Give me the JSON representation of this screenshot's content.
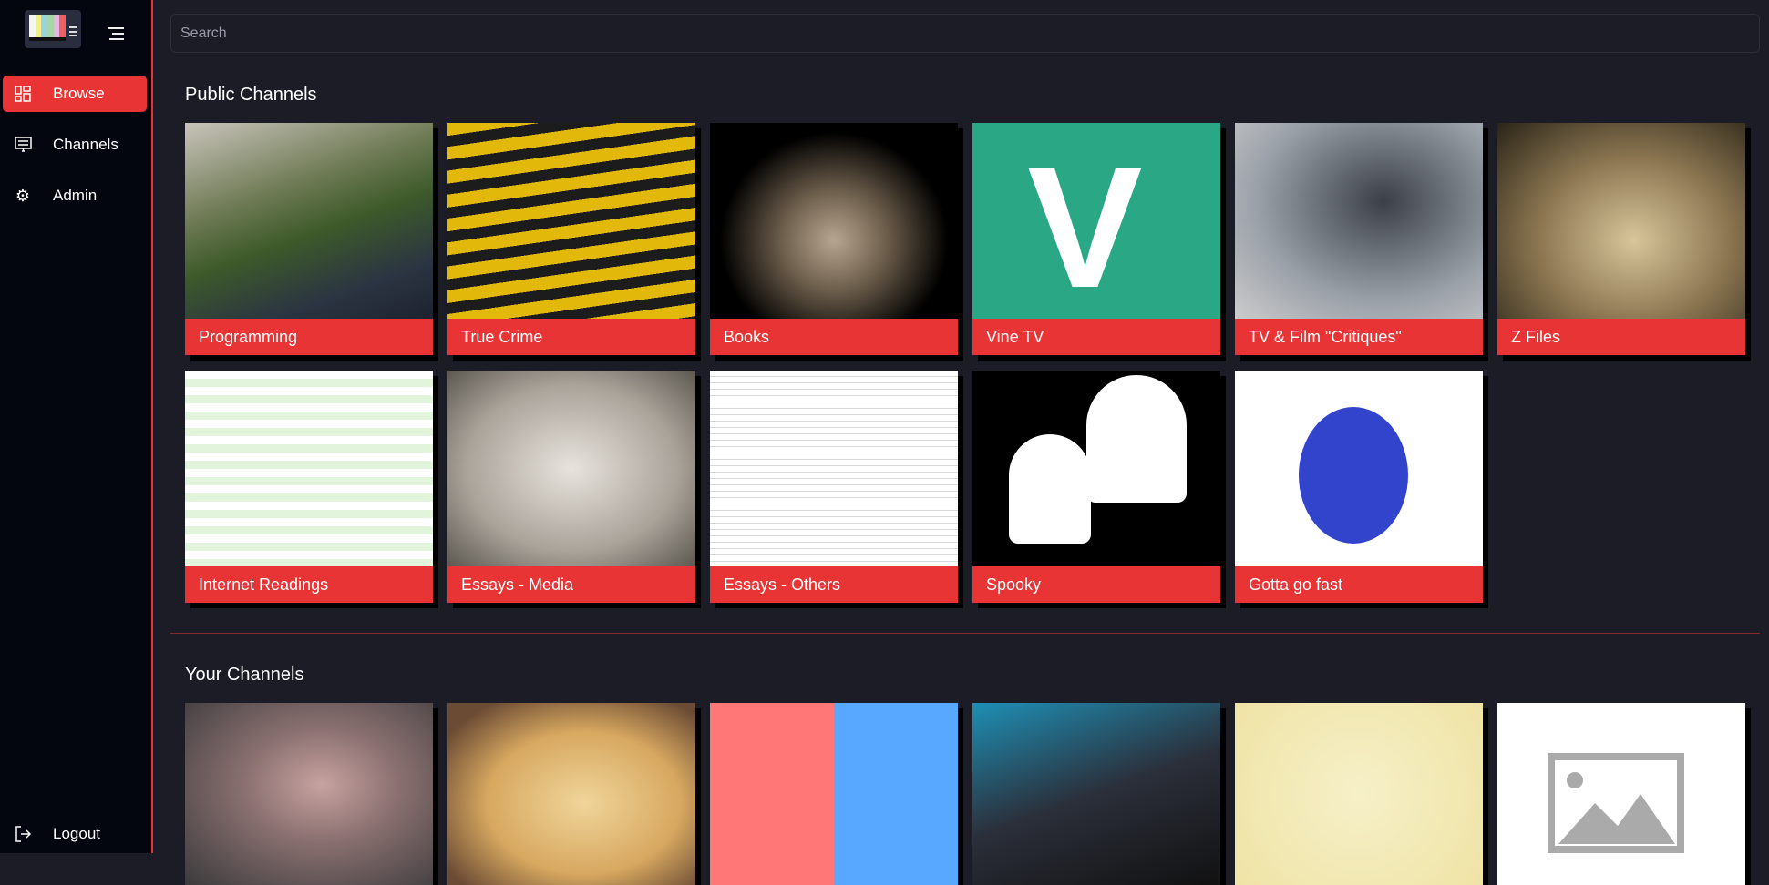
{
  "sidebar": {
    "items": [
      {
        "label": "Browse",
        "icon": "dashboard-icon",
        "active": true
      },
      {
        "label": "Channels",
        "icon": "monitor-icon"
      },
      {
        "label": "Admin",
        "icon": "gear-icon"
      }
    ],
    "logout": {
      "label": "Logout",
      "icon": "logout-icon"
    }
  },
  "search": {
    "placeholder": "Search"
  },
  "public": {
    "title": "Public Channels",
    "channels": [
      {
        "label": "Programming"
      },
      {
        "label": "True Crime"
      },
      {
        "label": "Books"
      },
      {
        "label": "Vine TV"
      },
      {
        "label": "TV & Film \"Critiques\""
      },
      {
        "label": "Z Files"
      },
      {
        "label": "Internet Readings"
      },
      {
        "label": "Essays - Media"
      },
      {
        "label": "Essays - Others"
      },
      {
        "label": "Spooky"
      },
      {
        "label": "Gotta go fast"
      }
    ]
  },
  "yours": {
    "title": "Your Channels"
  },
  "colors": {
    "accent": "#e83434",
    "sidebar_bg": "#03050f",
    "main_bg": "#1c1c26"
  }
}
